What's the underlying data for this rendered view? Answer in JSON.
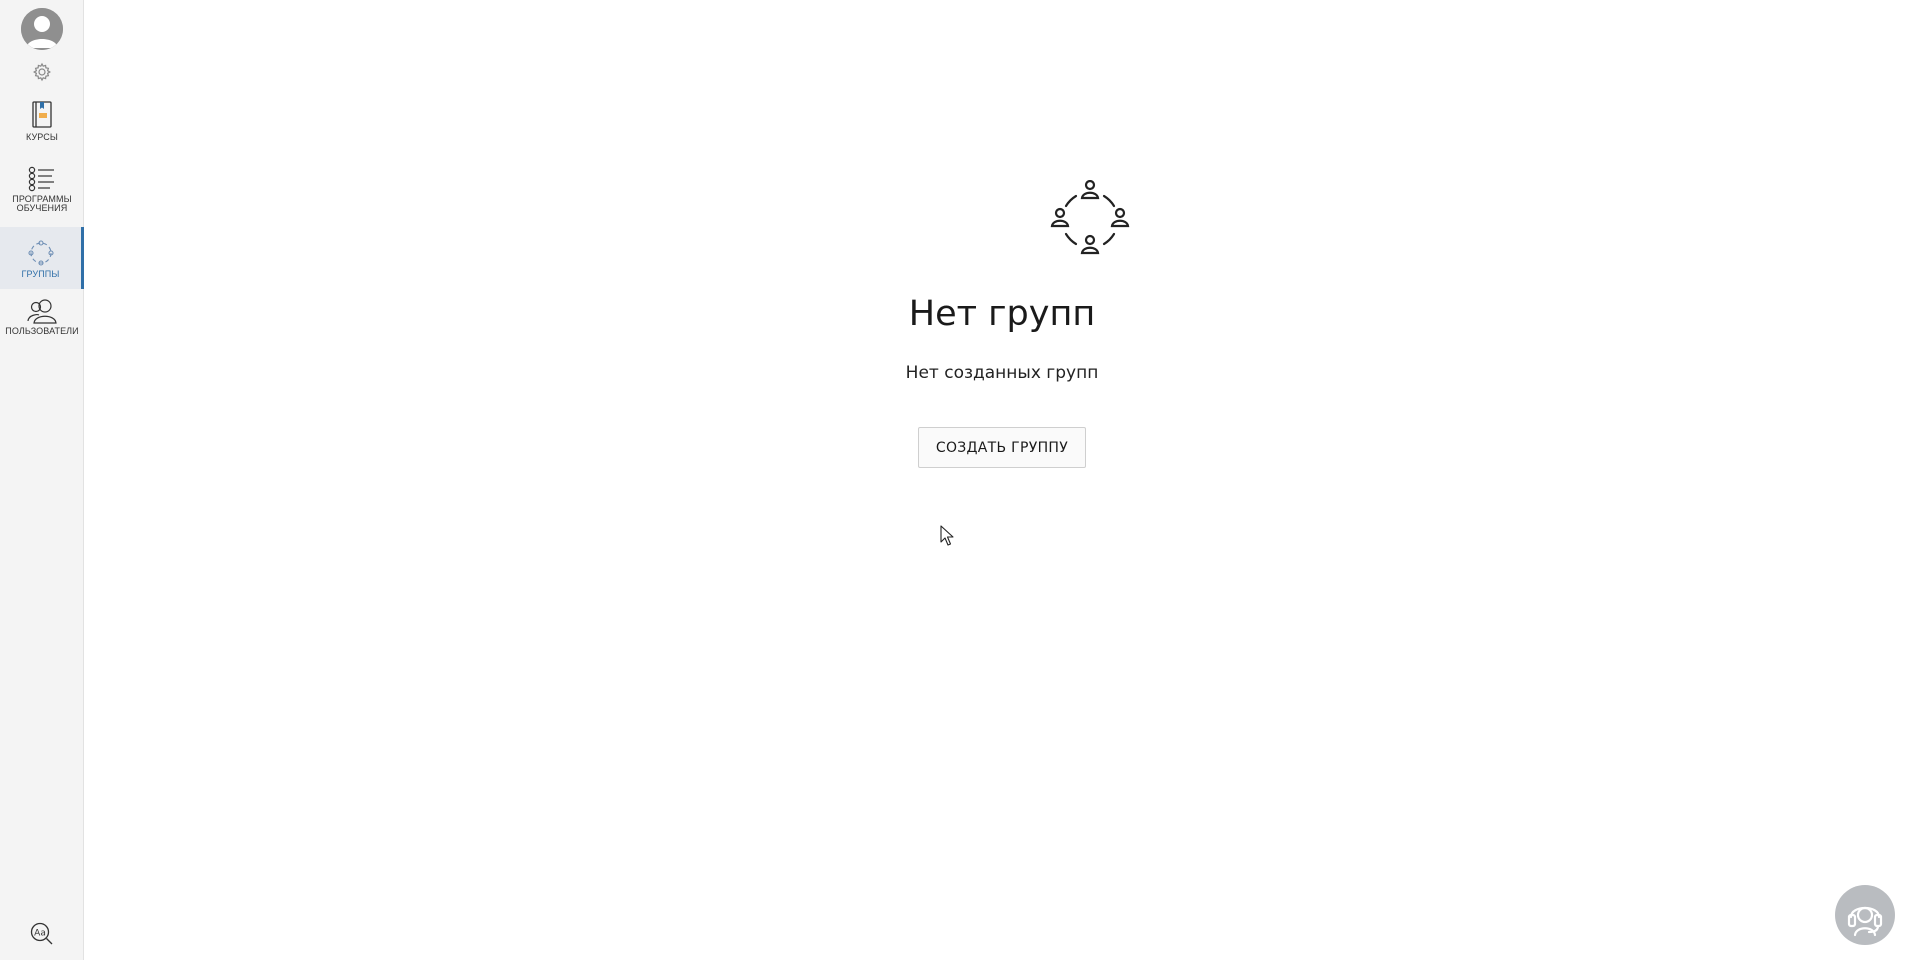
{
  "sidebar": {
    "items": [
      {
        "label": "КУРСЫ"
      },
      {
        "label": "ПРОГРАММЫ\nОБУЧЕНИЯ"
      },
      {
        "label": "ГРУППЫ"
      },
      {
        "label": "ПОЛЬЗОВАТЕЛИ"
      }
    ],
    "active_item": "ГРУППЫ",
    "icons": [
      "avatar-icon",
      "gear-icon",
      "book-icon",
      "checklist-icon",
      "group-circle-icon",
      "users-icon",
      "font-search-icon"
    ]
  },
  "empty_state": {
    "icon": "group-circle-icon",
    "title": "Нет групп",
    "subtitle": "Нет созданных групп",
    "button_label": "СОЗДАТЬ ГРУППУ"
  },
  "support": {
    "icon": "headset-support-icon"
  },
  "colors": {
    "accent": "#2f6fa8",
    "sidebar_bg": "#f4f4f4",
    "active_bg": "#e6e9ee",
    "support_bg": "#b9bcc0"
  }
}
